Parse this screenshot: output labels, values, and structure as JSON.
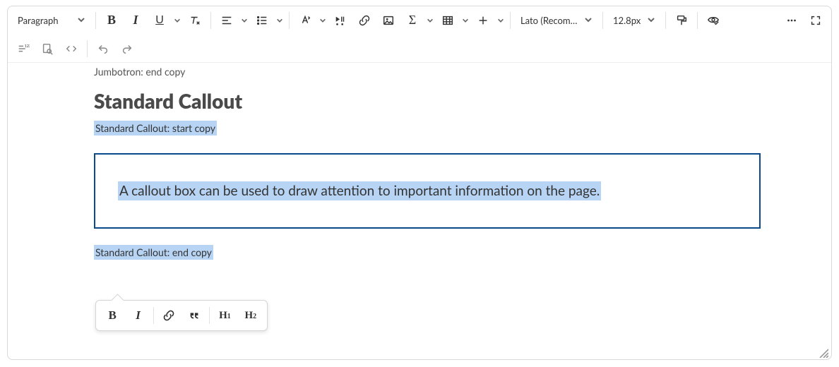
{
  "toolbar": {
    "paragraph_label": "Paragraph",
    "font_label": "Lato (Recomme…",
    "size_label": "12.8px"
  },
  "content": {
    "above": "Jumbotron: end copy",
    "heading": "Standard Callout",
    "start_tag": "Standard Callout: start copy",
    "callout_text": "A callout box can be used to draw attention to important information on the page.",
    "end_tag": "Standard Callout: end copy"
  },
  "float": {
    "h1": "H",
    "h1_sub": "1",
    "h2": "H",
    "h2_sub": "2"
  }
}
